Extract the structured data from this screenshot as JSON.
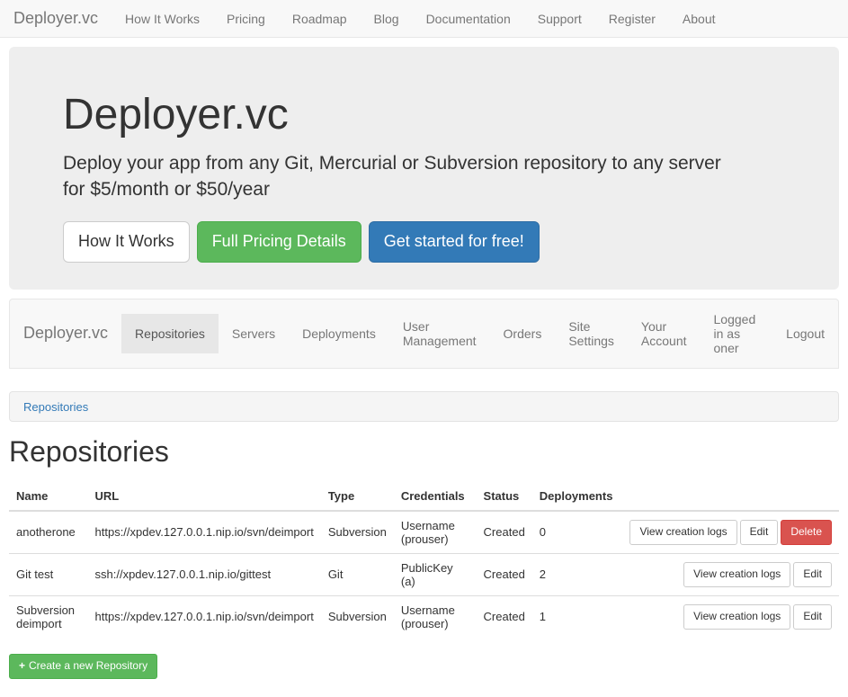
{
  "topnav": {
    "brand": "Deployer.vc",
    "items": [
      "How It Works",
      "Pricing",
      "Roadmap",
      "Blog",
      "Documentation",
      "Support",
      "Register",
      "About"
    ]
  },
  "hero": {
    "title": "Deployer.vc",
    "subtitle": "Deploy your app from any Git, Mercurial or Subversion repository to any server for $5/month or $50/year",
    "btn_how": "How It Works",
    "btn_pricing": "Full Pricing Details",
    "btn_start": "Get started for free!"
  },
  "subnav": {
    "brand": "Deployer.vc",
    "items": [
      {
        "label": "Repositories",
        "active": true
      },
      {
        "label": "Servers",
        "active": false
      },
      {
        "label": "Deployments",
        "active": false
      },
      {
        "label": "User Management",
        "active": false
      },
      {
        "label": "Orders",
        "active": false
      },
      {
        "label": "Site Settings",
        "active": false
      },
      {
        "label": "Your Account",
        "active": false
      },
      {
        "label": "Logged in as oner",
        "active": false
      },
      {
        "label": "Logout",
        "active": false
      }
    ]
  },
  "breadcrumb": {
    "label": "Repositories"
  },
  "page_title": "Repositories",
  "table": {
    "headers": [
      "Name",
      "URL",
      "Type",
      "Credentials",
      "Status",
      "Deployments"
    ],
    "rows": [
      {
        "name": "anotherone",
        "url": "https://xpdev.127.0.0.1.nip.io/svn/deimport",
        "type": "Subversion",
        "credentials": "Username (prouser)",
        "status": "Created",
        "deployments": "0",
        "has_delete": true
      },
      {
        "name": "Git test",
        "url": "ssh://xpdev.127.0.0.1.nip.io/gittest",
        "type": "Git",
        "credentials": "PublicKey (a)",
        "status": "Created",
        "deployments": "2",
        "has_delete": false
      },
      {
        "name": "Subversion deimport",
        "url": "https://xpdev.127.0.0.1.nip.io/svn/deimport",
        "type": "Subversion",
        "credentials": "Username (prouser)",
        "status": "Created",
        "deployments": "1",
        "has_delete": false
      }
    ]
  },
  "action_labels": {
    "view_logs": "View creation logs",
    "edit": "Edit",
    "delete": "Delete"
  },
  "create_button": "Create a new Repository"
}
